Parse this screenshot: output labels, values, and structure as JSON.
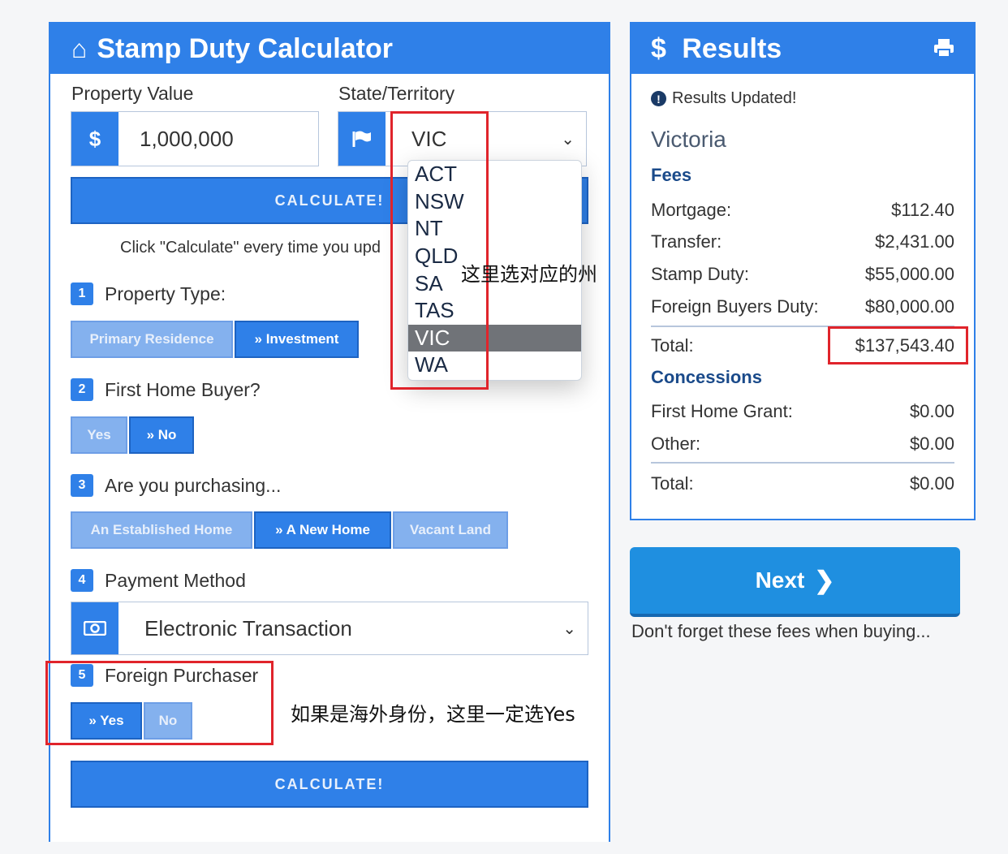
{
  "calc": {
    "title": "Stamp Duty Calculator",
    "home_icon": "home-icon",
    "property_value_label": "Property Value",
    "property_value_prefix": "$",
    "property_value": "1,000,000",
    "state_label": "State/Territory",
    "state_icon": "flag-icon",
    "state_value": "VIC",
    "state_options": [
      "ACT",
      "NSW",
      "NT",
      "QLD",
      "SA",
      "TAS",
      "VIC",
      "WA"
    ],
    "calculate_label": "CALCULATE!",
    "hint_text": "Click \"Calculate\" every time you upd",
    "step1": {
      "num": "1",
      "label": "Property Type:",
      "options": [
        "Primary Residence",
        "» Investment"
      ]
    },
    "step2": {
      "num": "2",
      "label": "First Home Buyer?",
      "options": [
        "Yes",
        "» No"
      ]
    },
    "step3": {
      "num": "3",
      "label": "Are you purchasing...",
      "options": [
        "An Established Home",
        "» A New Home",
        "Vacant Land"
      ]
    },
    "step4": {
      "num": "4",
      "label": "Payment Method",
      "value": "Electronic Transaction",
      "icon": "money-icon"
    },
    "step5": {
      "num": "5",
      "label": "Foreign Purchaser",
      "options": [
        "» Yes",
        "No"
      ]
    }
  },
  "annotations": {
    "state_note": "这里选对应的州",
    "foreign_note": "如果是海外身份，这里一定选Yes"
  },
  "results": {
    "title": "Results",
    "dollar_icon": "$",
    "updated": "Results Updated!",
    "state_name": "Victoria",
    "fees_heading": "Fees",
    "fees": [
      {
        "label": "Mortgage:",
        "value": "$112.40"
      },
      {
        "label": "Transfer:",
        "value": "$2,431.00"
      },
      {
        "label": "Stamp Duty:",
        "value": "$55,000.00"
      },
      {
        "label": "Foreign Buyers Duty:",
        "value": "$80,000.00"
      }
    ],
    "fees_total_label": "Total:",
    "fees_total": "$137,543.40",
    "concessions_heading": "Concessions",
    "concessions": [
      {
        "label": "First Home Grant:",
        "value": "$0.00"
      },
      {
        "label": "Other:",
        "value": "$0.00"
      }
    ],
    "concessions_total_label": "Total:",
    "concessions_total": "$0.00"
  },
  "next": {
    "label": "Next",
    "caption": "Don't forget these fees when buying..."
  },
  "colors": {
    "primary": "#2f80e8",
    "highlight": "#e0242b",
    "next": "#1f8fe0"
  }
}
